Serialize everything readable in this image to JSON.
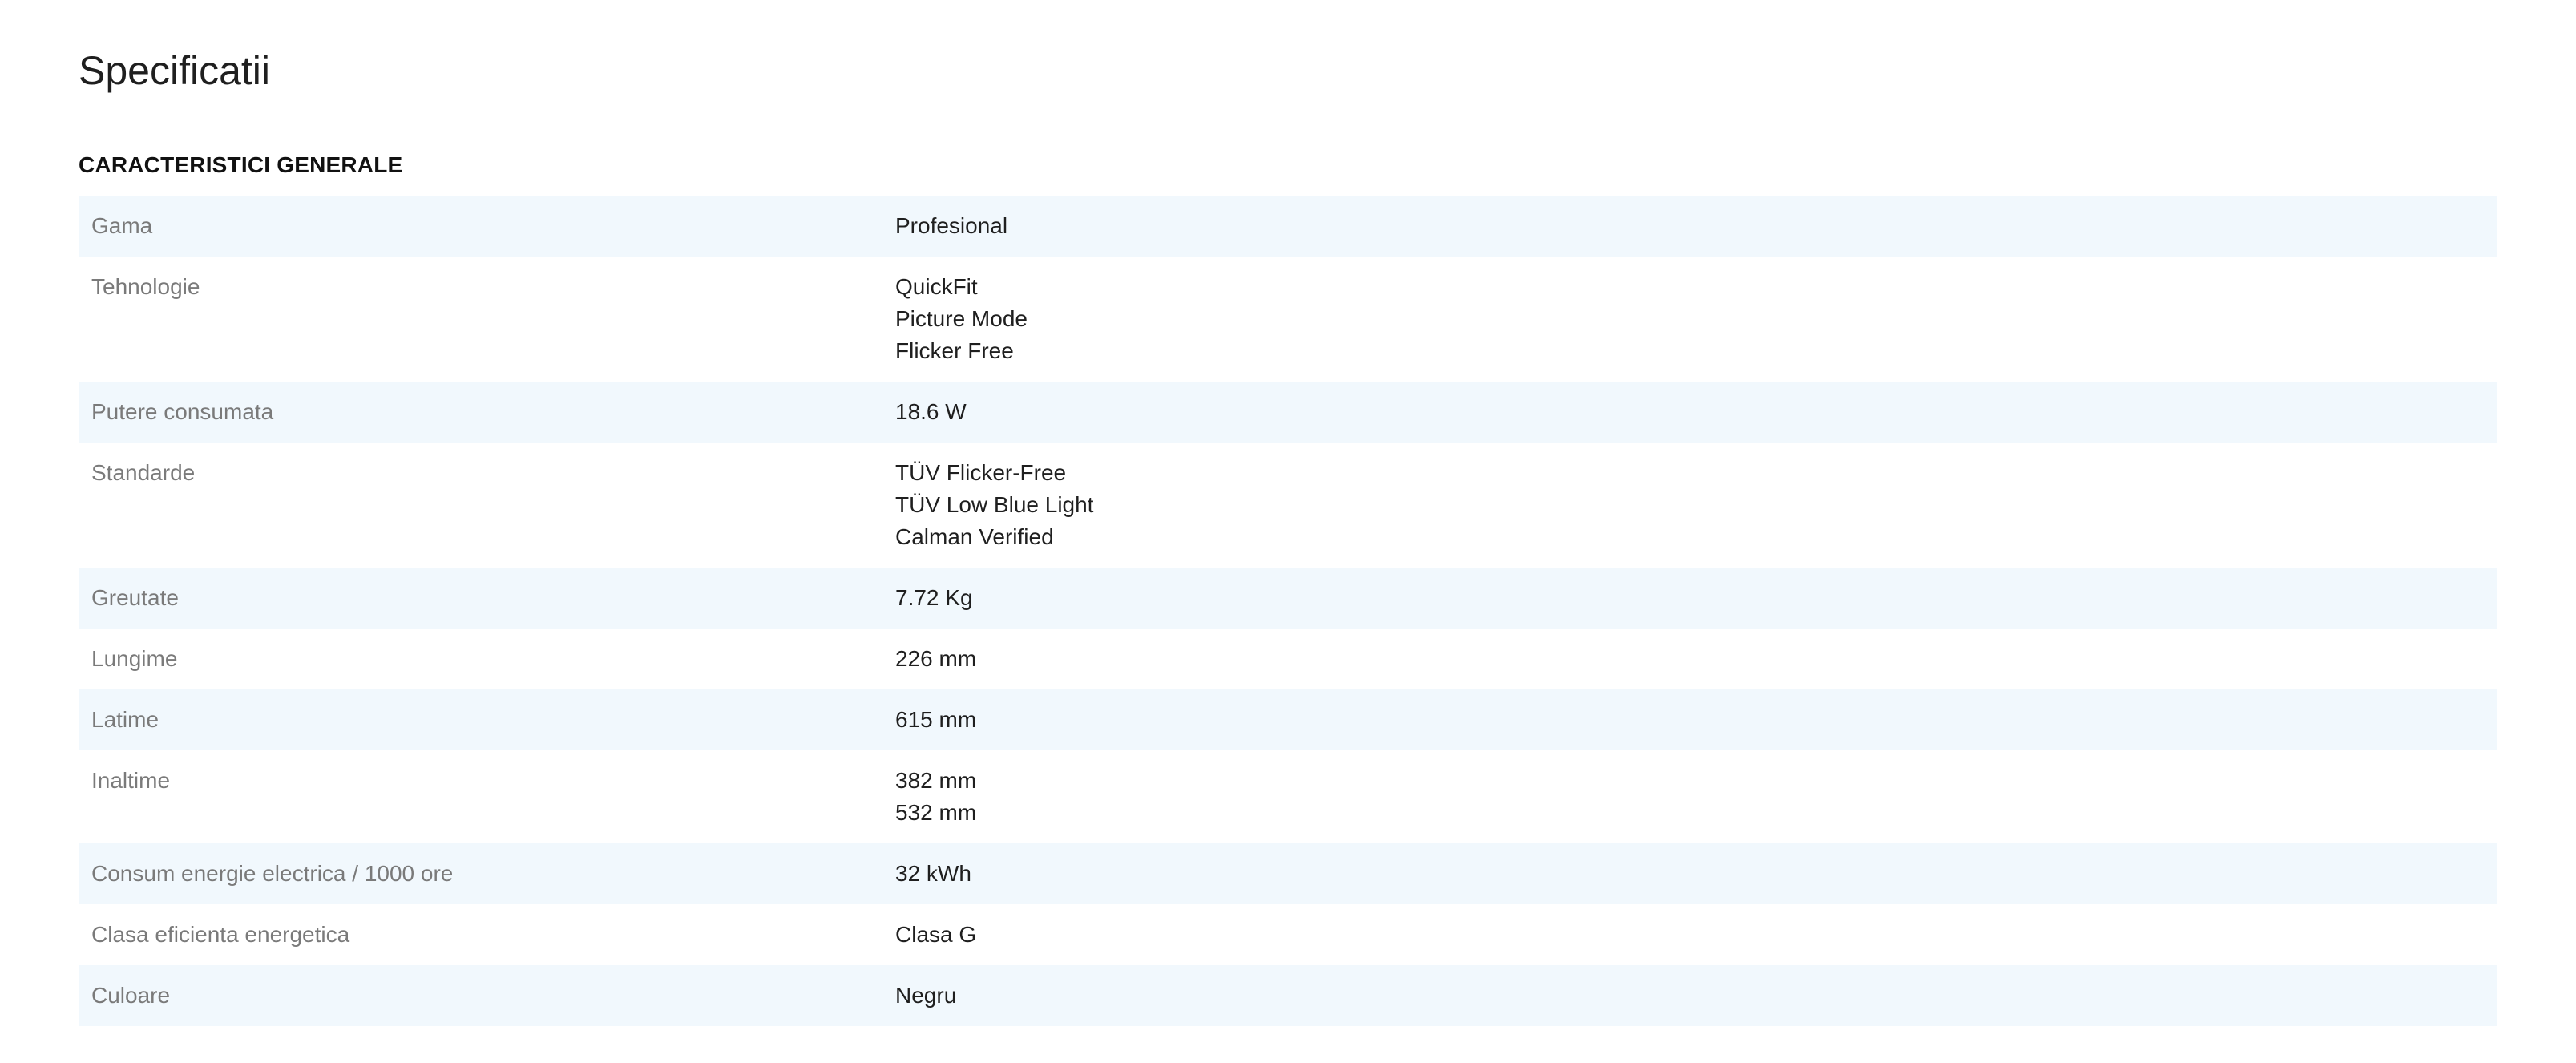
{
  "page": {
    "title": "Specificatii"
  },
  "section": {
    "title": "CARACTERISTICI GENERALE"
  },
  "specs": [
    {
      "label": "Gama",
      "values": [
        "Profesional"
      ]
    },
    {
      "label": "Tehnologie",
      "values": [
        "QuickFit",
        "Picture Mode",
        "Flicker Free"
      ]
    },
    {
      "label": "Putere consumata",
      "values": [
        "18.6 W"
      ]
    },
    {
      "label": "Standarde",
      "values": [
        "TÜV Flicker-Free",
        "TÜV Low Blue Light",
        "Calman Verified"
      ]
    },
    {
      "label": "Greutate",
      "values": [
        "7.72 Kg"
      ]
    },
    {
      "label": "Lungime",
      "values": [
        "226 mm"
      ]
    },
    {
      "label": "Latime",
      "values": [
        "615 mm"
      ]
    },
    {
      "label": "Inaltime",
      "values": [
        "382 mm",
        "532 mm"
      ]
    },
    {
      "label": "Consum energie electrica / 1000 ore",
      "values": [
        "32 kWh"
      ]
    },
    {
      "label": "Clasa eficienta energetica",
      "values": [
        "Clasa G"
      ]
    },
    {
      "label": "Culoare",
      "values": [
        "Negru"
      ]
    }
  ]
}
